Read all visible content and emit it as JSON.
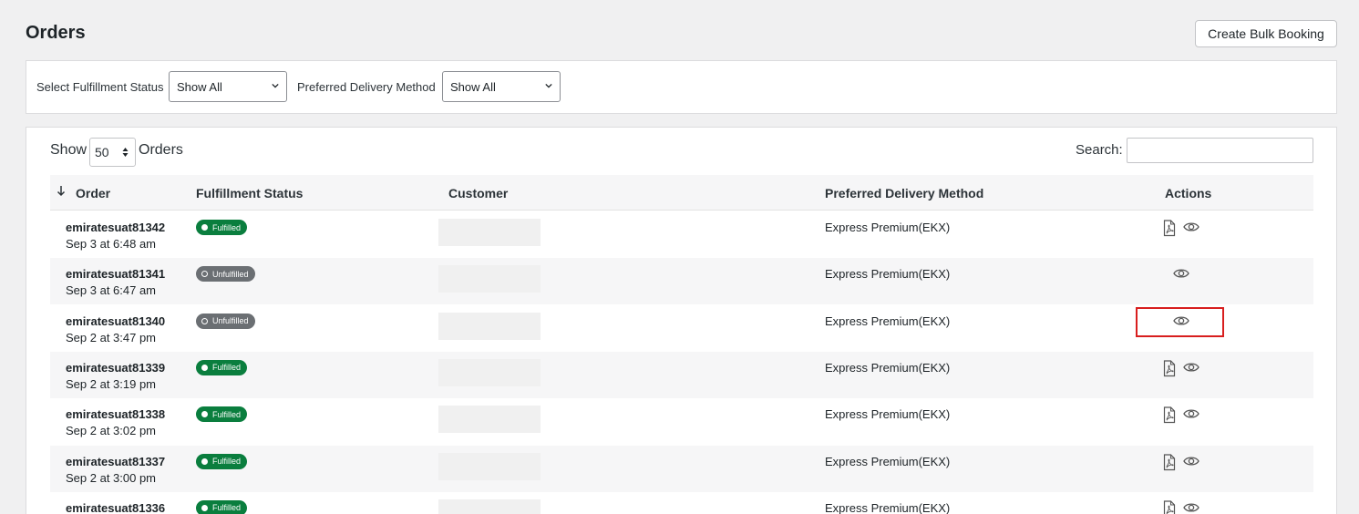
{
  "header": {
    "title": "Orders",
    "bulk_button": "Create Bulk Booking"
  },
  "filters": {
    "fulfillment_label": "Select Fulfillment Status",
    "fulfillment_value": "Show All",
    "delivery_label": "Preferred Delivery Method",
    "delivery_value": "Show All"
  },
  "table_controls": {
    "show_label": "Show",
    "page_length": "50",
    "orders_label": "Orders",
    "search_label": "Search:",
    "search_value": ""
  },
  "columns": {
    "order": "Order",
    "fulfillment": "Fulfillment Status",
    "customer": "Customer",
    "delivery": "Preferred Delivery Method",
    "actions": "Actions"
  },
  "rows": [
    {
      "order": "emiratesuat81342",
      "date": "Sep 3 at 6:48 am",
      "status": "Fulfilled",
      "delivery": "Express Premium(EKX)",
      "has_pdf": true
    },
    {
      "order": "emiratesuat81341",
      "date": "Sep 3 at 6:47 am",
      "status": "Unfulfilled",
      "delivery": "Express Premium(EKX)",
      "has_pdf": false
    },
    {
      "order": "emiratesuat81340",
      "date": "Sep 2 at 3:47 pm",
      "status": "Unfulfilled",
      "delivery": "Express Premium(EKX)",
      "has_pdf": false,
      "highlighted": true
    },
    {
      "order": "emiratesuat81339",
      "date": "Sep 2 at 3:19 pm",
      "status": "Fulfilled",
      "delivery": "Express Premium(EKX)",
      "has_pdf": true
    },
    {
      "order": "emiratesuat81338",
      "date": "Sep 2 at 3:02 pm",
      "status": "Fulfilled",
      "delivery": "Express Premium(EKX)",
      "has_pdf": true
    },
    {
      "order": "emiratesuat81337",
      "date": "Sep 2 at 3:00 pm",
      "status": "Fulfilled",
      "delivery": "Express Premium(EKX)",
      "has_pdf": true
    },
    {
      "order": "emiratesuat81336",
      "date": "",
      "status": "Fulfilled",
      "delivery": "Express Premium(EKX)",
      "has_pdf": true
    }
  ],
  "icons": {
    "pdf": "pdf-icon",
    "view": "eye-icon",
    "sort": "sort-down-icon",
    "select_caret": "chevron-down-icon"
  },
  "colors": {
    "fulfilled": "#0a7e3e",
    "unfulfilled": "#6b6f73",
    "highlight": "#d81e1e"
  }
}
